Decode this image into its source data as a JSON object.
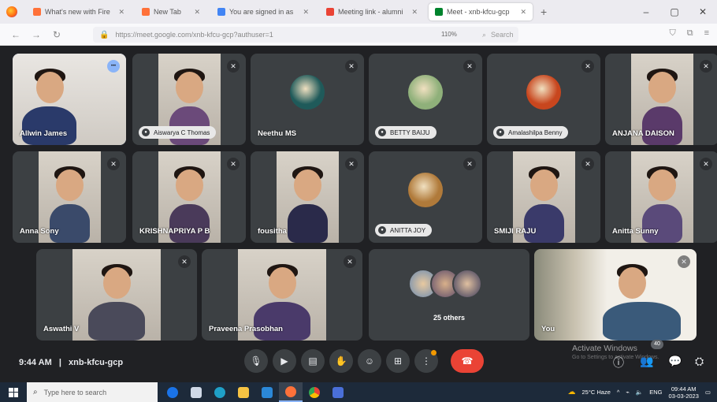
{
  "browser": {
    "tabs": [
      {
        "title": "What's new with Firefox - Mo",
        "icon_color": "#ff7139",
        "active": false
      },
      {
        "title": "New Tab",
        "icon_color": "#ff7139",
        "active": false
      },
      {
        "title": "You are signed in as NSD",
        "icon_color": "#4285f4",
        "active": false
      },
      {
        "title": "Meeting link - alumnimom",
        "icon_color": "#ea4335",
        "active": false
      },
      {
        "title": "Meet - xnb-kfcu-gcp",
        "icon_color": "#00832d",
        "active": true
      }
    ],
    "url": "https://meet.google.com/xnb-kfcu-gcp?authuser=1",
    "zoom": "110%",
    "search_placeholder": "Search"
  },
  "participants": [
    {
      "name": "Allwin James",
      "label_style": "plain",
      "video": true,
      "selected": true
    },
    {
      "name": "Aiswarya C Thomas",
      "label_style": "pill",
      "video": true
    },
    {
      "name": "Neethu MS",
      "label_style": "plain",
      "video": false,
      "avatar_color": "#1f5a5a"
    },
    {
      "name": "BETTY BAIJU",
      "label_style": "pill",
      "video": false,
      "avatar_color": "#8fb07a"
    },
    {
      "name": "Amalashilpa Benny",
      "label_style": "pill",
      "video": false,
      "avatar_color": "#c8461e"
    },
    {
      "name": "ANJANA DAISON",
      "label_style": "plain",
      "video": true
    },
    {
      "name": "Anna Sony",
      "label_style": "plain",
      "video": true
    },
    {
      "name": "KRISHNAPRIYA P B",
      "label_style": "plain",
      "video": true
    },
    {
      "name": "fousitha",
      "label_style": "plain",
      "video": true
    },
    {
      "name": "ANITTA JOY",
      "label_style": "pill",
      "video": false,
      "avatar_color": "#b07a3a"
    },
    {
      "name": "SMIJI RAJU",
      "label_style": "plain",
      "video": true
    },
    {
      "name": "Anitta Sunny",
      "label_style": "plain",
      "video": true
    },
    {
      "name": "Aswathi V",
      "label_style": "plain",
      "video": true
    },
    {
      "name": "Praveena Prasobhan",
      "label_style": "plain",
      "video": true
    },
    {
      "name": "You",
      "label_style": "plain",
      "video": true
    }
  ],
  "others": {
    "label": "25 others"
  },
  "meeting": {
    "time": "9:44 AM",
    "code": "xnb-kfcu-gcp",
    "participant_count": "40"
  },
  "controls": [
    "mic-button",
    "camera-button",
    "captions-button",
    "raise-hand-button",
    "emoji-button",
    "present-button",
    "more-options-button",
    "end-call-button"
  ],
  "watermark": {
    "title": "Activate Windows",
    "subtitle": "Go to Settings to activate Windows."
  },
  "taskbar": {
    "search_placeholder": "Type here to search",
    "weather": "25°C  Haze",
    "lang": "ENG",
    "time": "09:44 AM",
    "date": "03-03-2023"
  },
  "colors": {
    "meet_bg": "#202124",
    "tile_bg": "#3c4043",
    "end_call": "#ea4335",
    "selected_outline": "#8ab4f8"
  }
}
